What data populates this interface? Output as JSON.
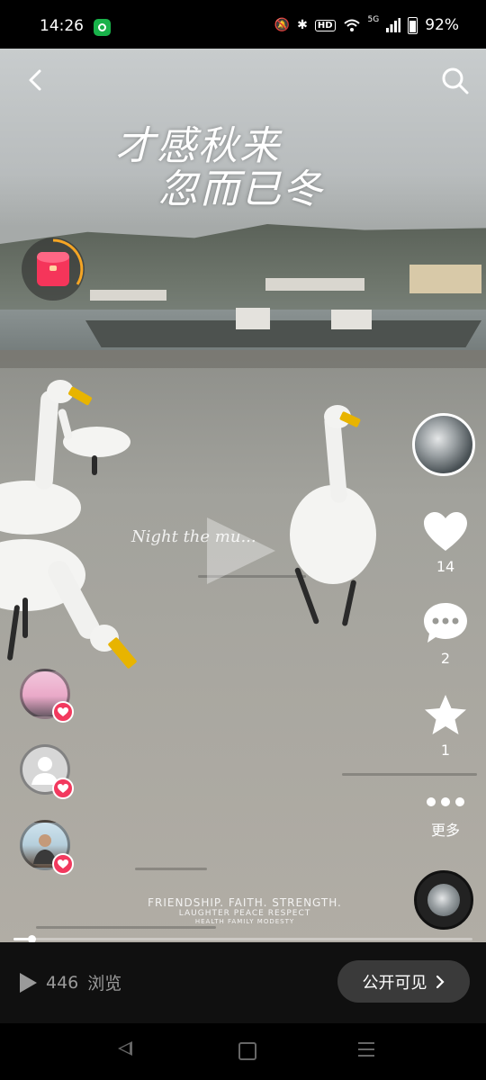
{
  "status_bar": {
    "time": "14:26",
    "battery": "92%",
    "network": "5G",
    "hd_label": "HD",
    "icons": [
      "app-notification-icon",
      "mute-icon",
      "bluetooth-icon",
      "hd-icon",
      "wifi-icon",
      "signal-icon",
      "battery-icon"
    ]
  },
  "video": {
    "title_line1": "才感秋来",
    "title_line2": "忽而已冬",
    "caption_script": "Night the mu...",
    "motto_line1": "FRIENDSHIP. FAITH. STRENGTH.",
    "motto_line2": "LAUGHTER PEACE RESPECT",
    "motto_line3": "HEALTH FAMILY MODESTY",
    "progress_fraction": 0.04
  },
  "overlay": {
    "back_icon": "chevron-left-icon",
    "search_icon": "search-icon",
    "red_packet_icon": "red-packet-icon"
  },
  "actions": {
    "like_count": "14",
    "comment_count": "2",
    "favorite_count": "1",
    "more_label": "更多"
  },
  "visitors": [
    {
      "name": "visitor-1"
    },
    {
      "name": "visitor-2"
    },
    {
      "name": "visitor-3"
    }
  ],
  "bottom": {
    "views_count": "446",
    "views_label": "浏览",
    "visibility_label": "公开可见"
  },
  "colors": {
    "accent_pink": "#f2395e",
    "status_green": "#19b24a",
    "background": "#000000"
  }
}
